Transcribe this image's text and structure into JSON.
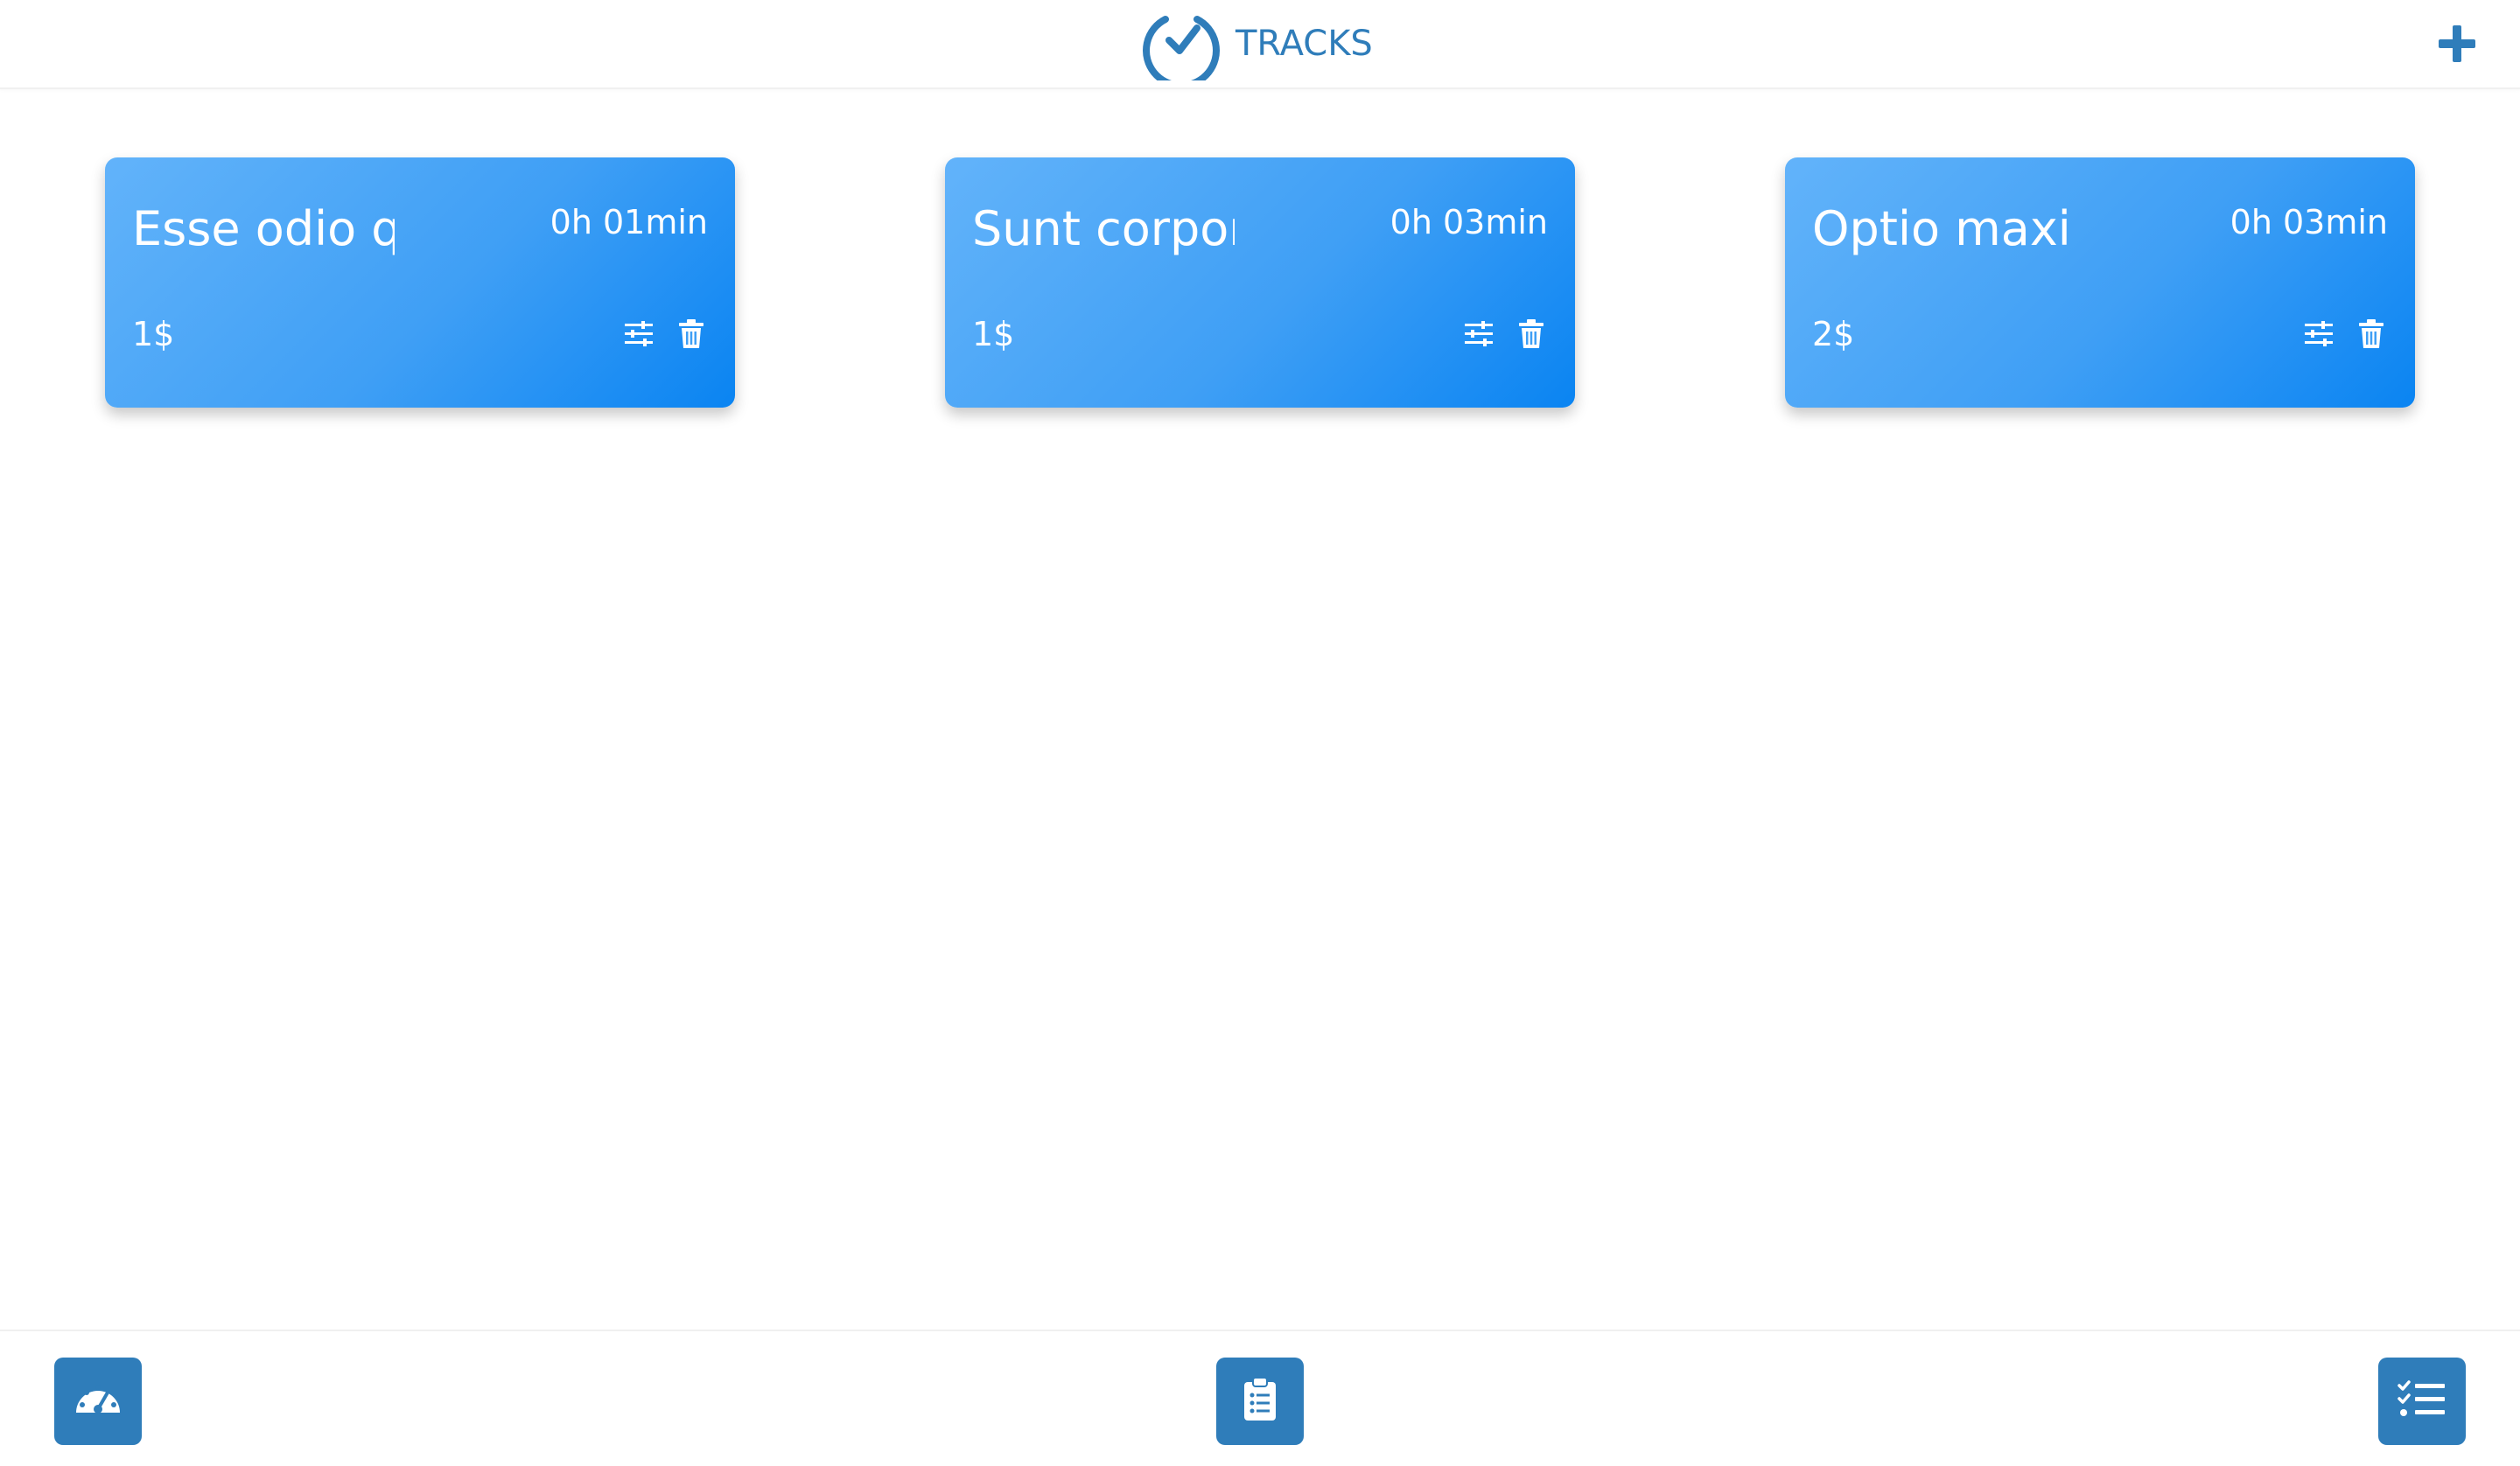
{
  "header": {
    "title": "TRACKS",
    "logo_icon": "clock-check-icon",
    "add_icon": "plus-icon"
  },
  "colors": {
    "brand": "#2f7dba",
    "card_gradient_start": "#62b3fa",
    "card_gradient_end": "#0a84f2"
  },
  "tracks": [
    {
      "title": "Esse odio qu",
      "time": "0h 01min",
      "price": "1$"
    },
    {
      "title": "Sunt corpor",
      "time": "0h 03min",
      "price": "1$"
    },
    {
      "title": "Optio maxir",
      "time": "0h 03min",
      "price": "2$"
    }
  ],
  "card_icons": {
    "edit": "sliders-icon",
    "delete": "trash-icon"
  },
  "footer": {
    "nav_items": [
      {
        "icon": "dashboard-gauge-icon"
      },
      {
        "icon": "clipboard-list-icon"
      },
      {
        "icon": "checklist-icon"
      }
    ]
  }
}
